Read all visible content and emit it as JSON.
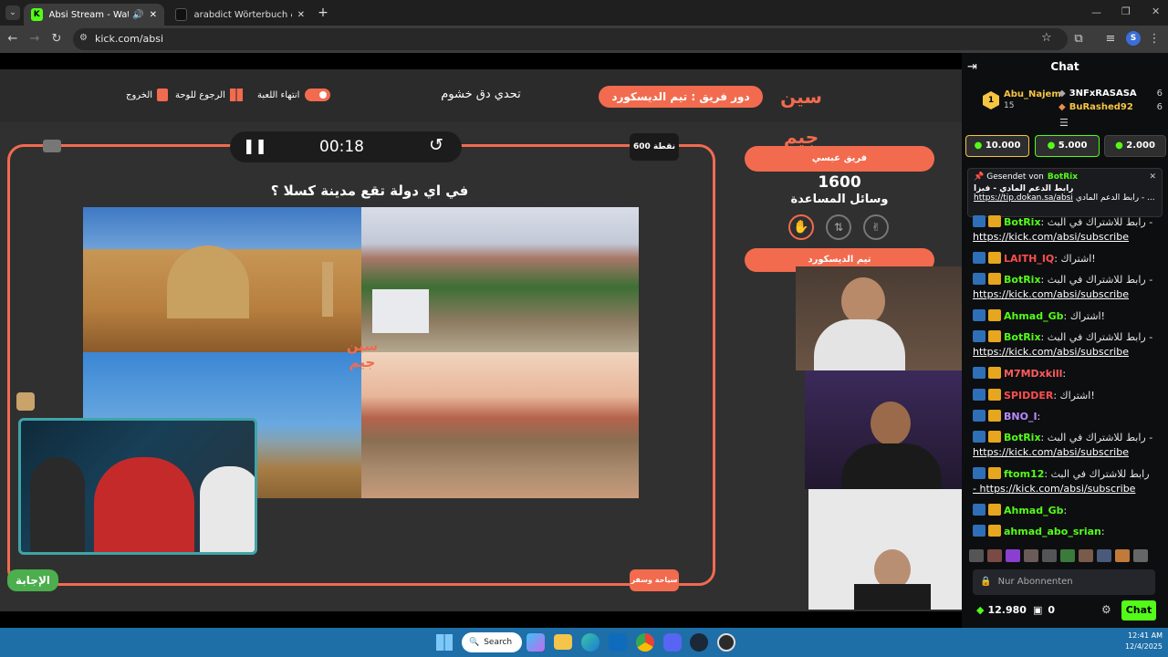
{
  "browser": {
    "tabs": [
      {
        "label": "Absi Stream - Watch Live o"
      },
      {
        "label": "arabdict Wörterbuch & Überset"
      }
    ],
    "new_tab": "+",
    "url": "kick.com/absi",
    "profile_initial": "S"
  },
  "game": {
    "brand": "سين جيم",
    "team_turn": "دور فريق : تيم الديسكورد",
    "challenge": "تحدي دق خشوم",
    "end_game": "انتهاء اللعبة",
    "back_to_board": "الرجوع للوحة",
    "exit": "الخروج",
    "timer": "00:18",
    "points": "600 نقطة",
    "question": "في اي دولة تقع مدينة كسلا ؟",
    "category": "سياحة وسفر",
    "answer_button": "الإجابة",
    "team1_name": "فريق عبسي",
    "team1_score": "1600",
    "helpers_label": "وسائل المساعدة",
    "team2_name": "تيم الديسكورد"
  },
  "chat": {
    "title": "Chat",
    "top_user": "Abu_Najem",
    "top_user_count": "15",
    "top_list": [
      {
        "name": "3NFxRASASA",
        "count": "6"
      },
      {
        "name": "BuRashed92",
        "count": "6"
      }
    ],
    "gift_amounts": [
      "10.000",
      "5.000",
      "2.000"
    ],
    "pinned_by": "Gesendet von",
    "pinned_user": "BotRix",
    "pinned_text": "رابط الدعم المادي - فيزا",
    "pinned_link": "https://tip.dokan.sa/absi",
    "pinned_tail": "رابط الدعم المادي - ...",
    "messages": [
      {
        "user": "BotRix",
        "color": "#53fc18",
        "text": "رابط للاشتراك في البث -",
        "link": "https://kick.com/absi/subscribe"
      },
      {
        "user": "LAITH_IQ",
        "color": "#ff4d4d",
        "text": "اشتراك!",
        "link": ""
      },
      {
        "user": "BotRix",
        "color": "#53fc18",
        "text": "رابط للاشتراك في البث -",
        "link": "https://kick.com/absi/subscribe"
      },
      {
        "user": "Ahmad_Gb",
        "color": "#53fc18",
        "text": "اشتراك!",
        "link": ""
      },
      {
        "user": "BotRix",
        "color": "#53fc18",
        "text": "رابط للاشتراك في البث -",
        "link": "https://kick.com/absi/subscribe"
      },
      {
        "user": "M7MDxkill",
        "color": "#ff5c5c",
        "text": "",
        "link": ""
      },
      {
        "user": "SPIDDER",
        "color": "#ff4d4d",
        "text": "اشتراك!",
        "link": ""
      },
      {
        "user": "BNO_I",
        "color": "#b88cff",
        "text": "",
        "link": ""
      },
      {
        "user": "BotRix",
        "color": "#53fc18",
        "text": "رابط للاشتراك في البث -",
        "link": "https://kick.com/absi/subscribe"
      },
      {
        "user": "ftom12",
        "color": "#53fc18",
        "text": "رابط للاشتراك في البث",
        "link": "- https://kick.com/absi/subscribe"
      },
      {
        "user": "Ahmad_Gb",
        "color": "#53fc18",
        "text": "",
        "link": ""
      },
      {
        "user": "ahmad_abo_srian",
        "color": "#53fc18",
        "text": "",
        "link": ""
      }
    ],
    "input_placeholder": "Nur Abonnenten",
    "balance": "12.980",
    "gift_count": "0",
    "send_button": "Chat"
  },
  "taskbar": {
    "search": "Search",
    "time": "12:41 AM",
    "date": "12/4/2025"
  }
}
